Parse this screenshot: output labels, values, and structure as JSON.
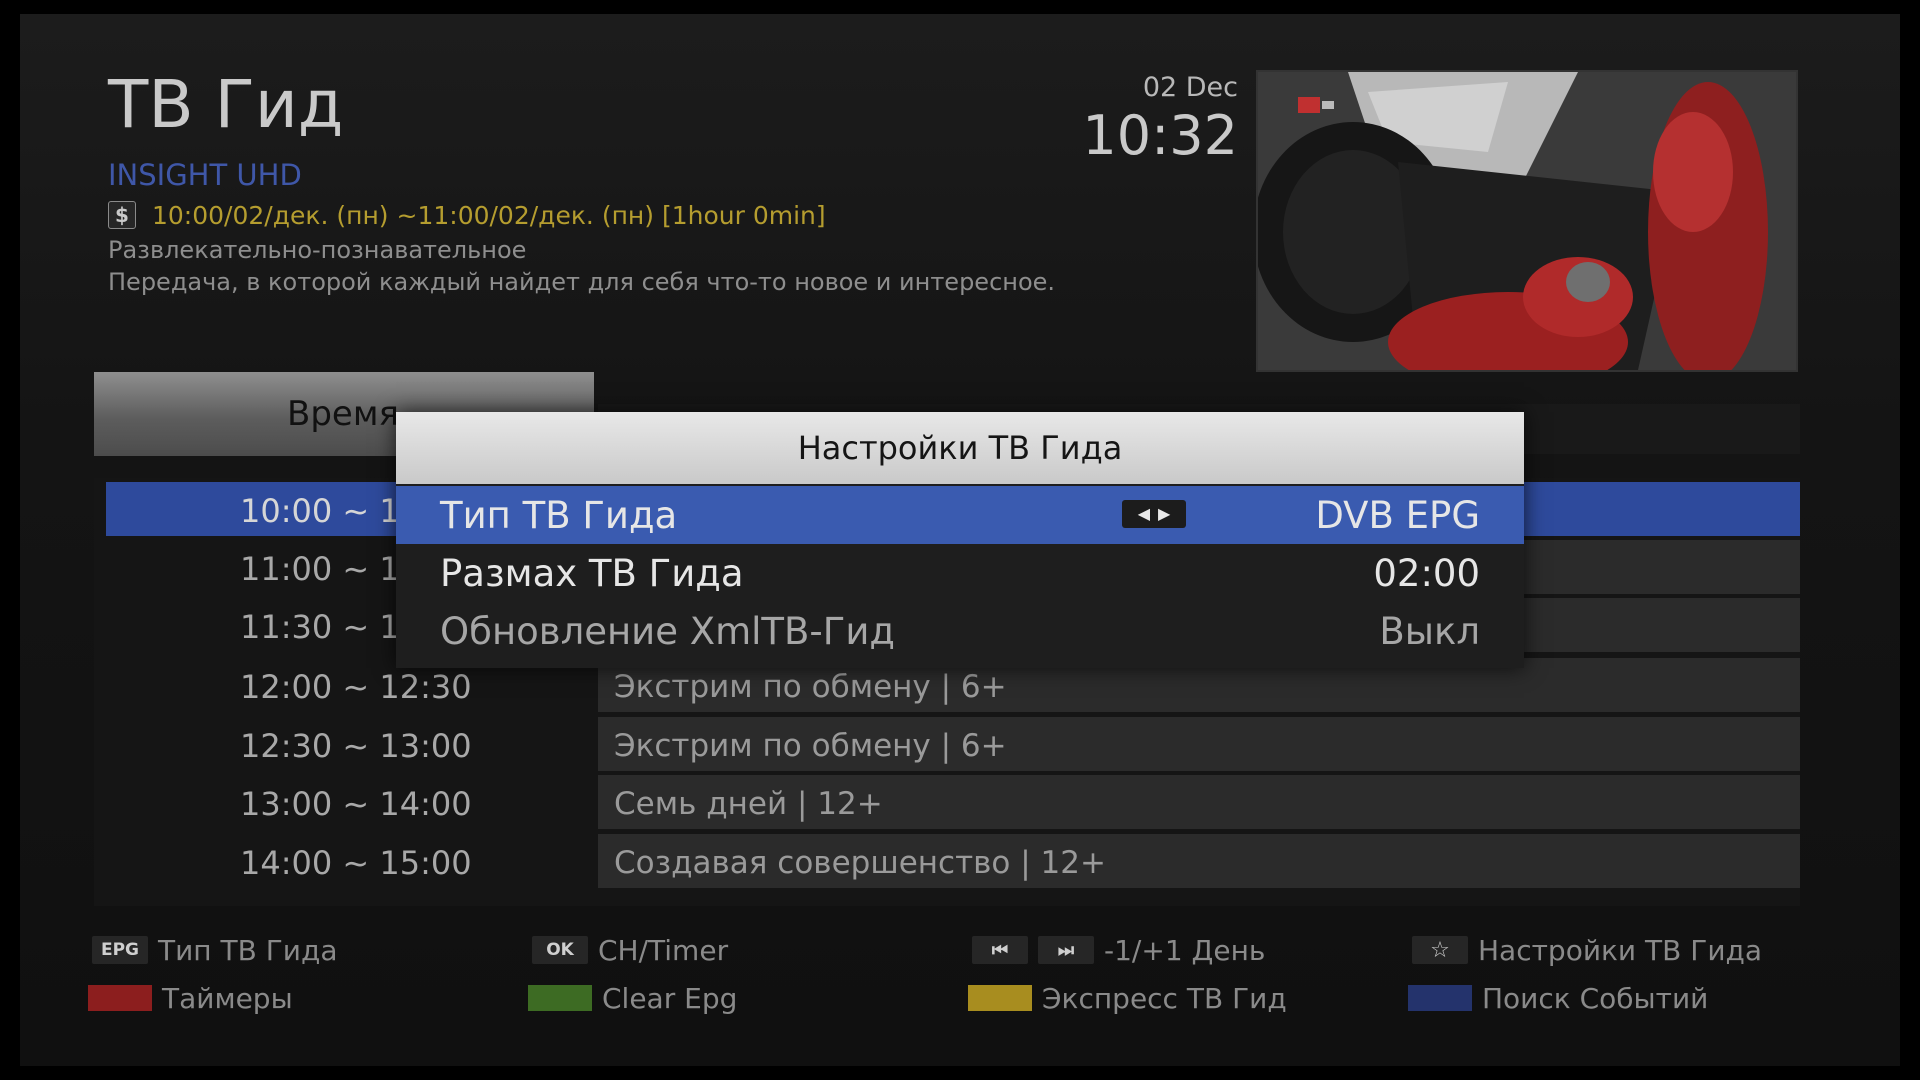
{
  "header": {
    "title": "ТВ Гид",
    "channel": "INSIGHT UHD",
    "schedule": "10:00/02/дек. (пн) ~11:00/02/дек. (пн)  [1hour 0min]",
    "currency_icon_text": "$",
    "genre": "Развлекательно-познавательное",
    "description": "Передача, в которой каждый найдет для себя что-то новое и интересное.",
    "date": "02 Dec",
    "clock": "10:32"
  },
  "list": {
    "time_header": "Время",
    "rows": [
      {
        "time": "10:00 ~ 11:00",
        "program": ""
      },
      {
        "time": "11:00 ~ 11:30",
        "program": ""
      },
      {
        "time": "11:30 ~ 12:00",
        "program": ""
      },
      {
        "time": "12:00 ~ 12:30",
        "program": "Экстрим по обмену | 6+"
      },
      {
        "time": "12:30 ~ 13:00",
        "program": "Экстрим по обмену | 6+"
      },
      {
        "time": "13:00 ~ 14:00",
        "program": "Семь дней | 12+"
      },
      {
        "time": "14:00 ~ 15:00",
        "program": "Создавая совершенство | 12+"
      }
    ]
  },
  "dialog": {
    "title": "Настройки ТВ Гида",
    "items": [
      {
        "label": "Тип ТВ Гида",
        "value": "DVB EPG"
      },
      {
        "label": "Размах ТВ Гида",
        "value": "02:00"
      },
      {
        "label": "Обновление XmlTB-Гид",
        "value": "Выкл"
      }
    ]
  },
  "legend": {
    "epg_key": "EPG",
    "epg_label": "Тип ТВ Гида",
    "ok_key": "OK",
    "ok_label": "CH/Timer",
    "day_label": "-1/+1 День",
    "settings_label": "Настройки ТВ Гида",
    "red_label": "Таймеры",
    "green_label": "Clear Epg",
    "yellow_label": "Экспресс ТВ Гид",
    "blue_label": "Поиск Событий"
  },
  "colors": {
    "selection": "#2e4a9c",
    "dialog_selection": "#3a5bb0",
    "channel": "#3f57a8",
    "schedule": "#b59d2f",
    "red": "#8c1e1e",
    "green": "#3d6b23",
    "yellow": "#a88d1f",
    "blue": "#24336c"
  }
}
